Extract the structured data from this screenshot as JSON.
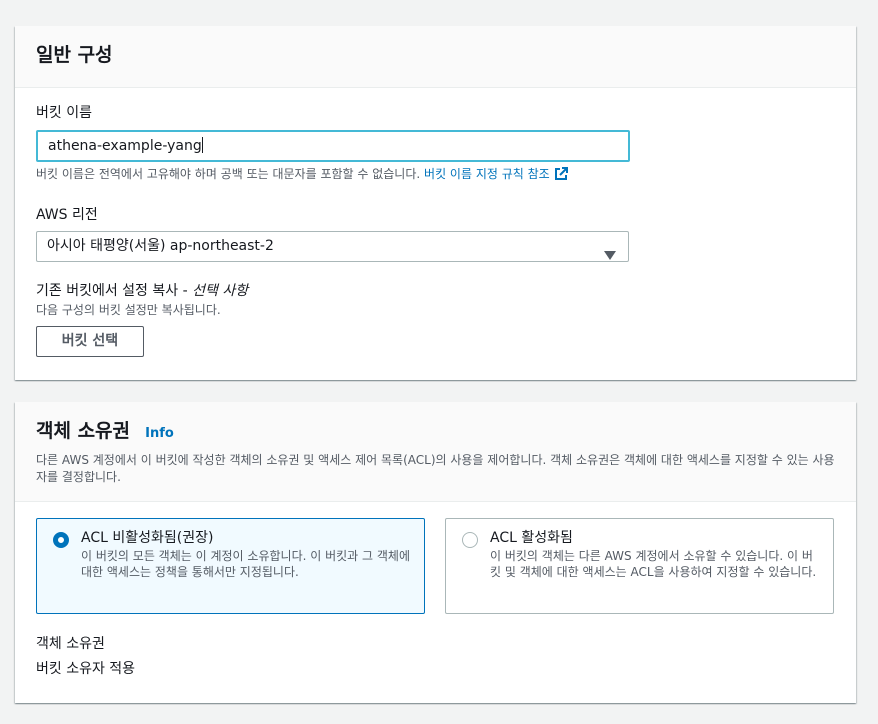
{
  "general": {
    "title": "일반 구성",
    "bucket_name_label": "버킷 이름",
    "bucket_name_value": "athena-example-yang",
    "bucket_name_hint": "버킷 이름은 전역에서 고유해야 하며 공백 또는 대문자를 포함할 수 없습니다.",
    "bucket_name_rules_link": "버킷 이름 지정 규칙 참조",
    "region_label": "AWS 리전",
    "region_value": "아시아 태평양(서울) ap-northeast-2",
    "copy_settings_label": "기존 버킷에서 설정 복사 -",
    "copy_settings_optional": "선택 사항",
    "copy_settings_hint": "다음 구성의 버킷 설정만 복사됩니다.",
    "choose_bucket_button": "버킷 선택"
  },
  "ownership": {
    "title": "객체 소유권",
    "info_link": "Info",
    "description": "다른 AWS 계정에서 이 버킷에 작성한 객체의 소유권 및 액세스 제어 목록(ACL)의 사용을 제어합니다. 객체 소유권은 객체에 대한 액세스를 지정할 수 있는 사용자를 결정합니다.",
    "options": [
      {
        "title": "ACL 비활성화됨(권장)",
        "desc": "이 버킷의 모든 객체는 이 계정이 소유합니다. 이 버킷과 그 객체에 대한 액세스는 정책을 통해서만 지정됩니다.",
        "selected": true
      },
      {
        "title": "ACL 활성화됨",
        "desc": "이 버킷의 객체는 다른 AWS 계정에서 소유할 수 있습니다. 이 버킷 및 객체에 대한 액세스는 ACL을 사용하여 지정할 수 있습니다.",
        "selected": false
      }
    ],
    "object_ownership_label": "객체 소유권",
    "object_ownership_value": "버킷 소유자 적용"
  },
  "colors": {
    "accent": "#0073bb",
    "focus_border": "#44b9d6",
    "background": "#f2f3f3"
  },
  "icons": {
    "external_link": "external-link-icon",
    "dropdown": "caret-down-icon",
    "radio": "radio-icon"
  }
}
